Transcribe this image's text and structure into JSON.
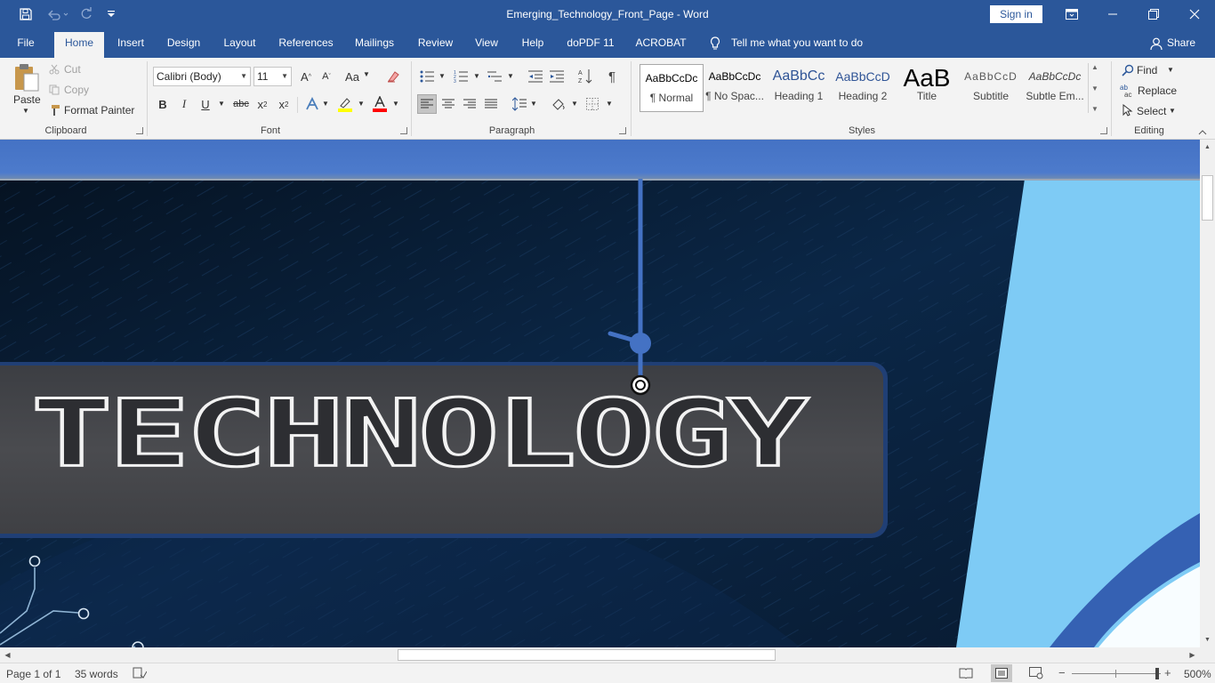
{
  "window": {
    "title": "Emerging_Technology_Front_Page  -  Word",
    "sign_in": "Sign in"
  },
  "tabs": [
    "File",
    "Home",
    "Insert",
    "Design",
    "Layout",
    "References",
    "Mailings",
    "Review",
    "View",
    "Help",
    "doPDF 11",
    "ACROBAT"
  ],
  "active_tab": "Home",
  "tell_me": "Tell me what you want to do",
  "share": "Share",
  "clipboard": {
    "paste": "Paste",
    "cut": "Cut",
    "copy": "Copy",
    "format_painter": "Format Painter",
    "label": "Clipboard"
  },
  "font": {
    "name": "Calibri (Body)",
    "size": "11",
    "label": "Font",
    "case_btn": "Aa",
    "bold": "B",
    "italic": "I",
    "underline": "U",
    "strike": "abc",
    "sub": "x",
    "sup": "x"
  },
  "paragraph": {
    "label": "Paragraph",
    "pilcrow": "¶"
  },
  "styles": {
    "label": "Styles",
    "items": [
      {
        "preview": "AaBbCcDc",
        "name": "¶ Normal"
      },
      {
        "preview": "AaBbCcDc",
        "name": "¶ No Spac..."
      },
      {
        "preview": "AaBbCc",
        "name": "Heading 1"
      },
      {
        "preview": "AaBbCcD",
        "name": "Heading 2"
      },
      {
        "preview": "AaB",
        "name": "Title"
      },
      {
        "preview": "AaBbCcD",
        "name": "Subtitle"
      },
      {
        "preview": "AaBbCcDc",
        "name": "Subtle Em..."
      }
    ]
  },
  "editing": {
    "find": "Find",
    "replace": "Replace",
    "select": "Select",
    "label": "Editing"
  },
  "document": {
    "heading_text": "TECHNOLOGY"
  },
  "status": {
    "page": "Page 1 of 1",
    "words": "35 words",
    "zoom": "500%"
  },
  "colors": {
    "accent": "#2b579a",
    "highlight": "#ffff00",
    "font_color": "#ff0000",
    "banner_blue": "#4472c4",
    "light_blue": "#7ecbf5"
  }
}
